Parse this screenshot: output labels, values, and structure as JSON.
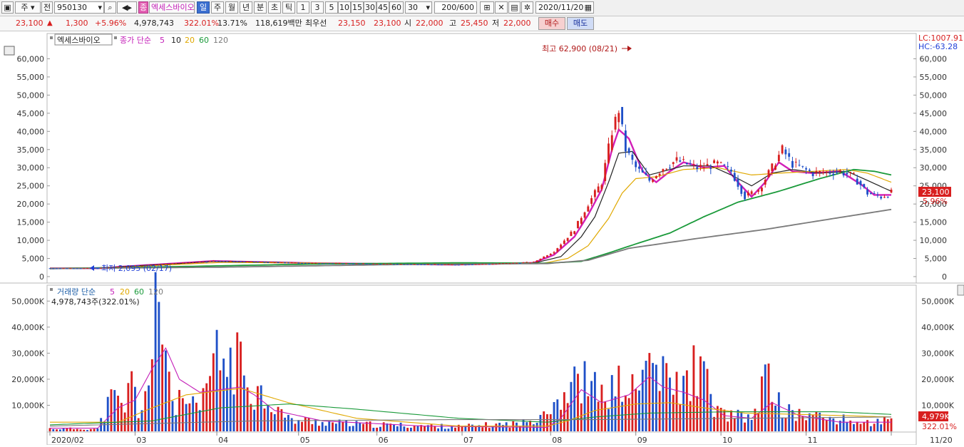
{
  "toolbar": {
    "period_type": "주",
    "prev_label": "전",
    "code": "950130",
    "stock_badge": "종",
    "stock_name": "엑세스바이오",
    "tf_day": "일",
    "tf_week": "주",
    "tf_month": "월",
    "tf_year": "년",
    "tf_min": "분",
    "tf_sec": "초",
    "tf_tick": "틱",
    "intervals": [
      "1",
      "3",
      "5",
      "10",
      "15",
      "30",
      "45",
      "60"
    ],
    "interval_select": "30",
    "count": "200",
    "count_total": "/600",
    "date": "2020/11/20"
  },
  "quote": {
    "price": "23,100",
    "up_arrow": "▲",
    "change": "1,300",
    "change_pct": "+5.96%",
    "volume": "4,978,743",
    "volume_pct": "322.01%",
    "turnover": "13.71%",
    "amount": "118,619백만",
    "best_label": "최우선",
    "best_ask": "23,150",
    "best_bid": "23,100",
    "open_label": "시",
    "open": "22,000",
    "high_label": "고",
    "high": "25,450",
    "low_label": "저",
    "low": "22,000",
    "buy_label": "매수",
    "sell_label": "매도"
  },
  "chart_data": [
    {
      "type": "candlestick",
      "title": "엑세스바이오",
      "legend_prefix": "종가 단순",
      "ma_periods": [
        "5",
        "10",
        "20",
        "60",
        "120"
      ],
      "ma_colors": [
        "#d21fb8",
        "#222222",
        "#e0a800",
        "#1a9a3a",
        "#7a7a7a"
      ],
      "ylim": [
        0,
        65000
      ],
      "y_ticks": [
        0,
        5000,
        10000,
        15000,
        20000,
        25000,
        30000,
        35000,
        40000,
        45000,
        50000,
        55000,
        60000
      ],
      "y_tick_labels": [
        "0",
        "5,000",
        "10,000",
        "15,000",
        "20,000",
        "25,000",
        "30,000",
        "35,000",
        "40,000",
        "45,000",
        "50,000",
        "55,000",
        "60,000"
      ],
      "lc_label": "LC:1007.91",
      "hc_label": "HC:-63.28",
      "high_annotation": "최고 62,900 (08/21)",
      "low_annotation": "최저 2,095 (02/17)",
      "last_price_label": "23,100",
      "last_change_label": "5.96%",
      "price_anchors": [
        [
          0,
          2300
        ],
        [
          14,
          2300
        ],
        [
          24,
          2900
        ],
        [
          36,
          3600
        ],
        [
          48,
          4300
        ],
        [
          62,
          4000
        ],
        [
          78,
          3700
        ],
        [
          98,
          3500
        ],
        [
          118,
          3300
        ],
        [
          130,
          3500
        ],
        [
          142,
          4000
        ],
        [
          148,
          7000
        ],
        [
          154,
          13000
        ],
        [
          158,
          20000
        ],
        [
          162,
          26000
        ],
        [
          165,
          40000
        ],
        [
          167,
          46000
        ],
        [
          169,
          35000
        ],
        [
          172,
          30000
        ],
        [
          176,
          26500
        ],
        [
          180,
          30000
        ],
        [
          184,
          32000
        ],
        [
          190,
          30000
        ],
        [
          196,
          31000
        ],
        [
          200,
          29000
        ],
        [
          204,
          22000
        ],
        [
          208,
          24000
        ],
        [
          212,
          30000
        ],
        [
          215,
          35000
        ],
        [
          218,
          31000
        ],
        [
          224,
          28500
        ],
        [
          232,
          29000
        ],
        [
          236,
          27500
        ],
        [
          240,
          23000
        ],
        [
          244,
          22000
        ],
        [
          247,
          23100
        ]
      ],
      "ma_anchors": {
        "5": [
          [
            0,
            2300
          ],
          [
            14,
            2300
          ],
          [
            24,
            2900
          ],
          [
            36,
            3600
          ],
          [
            48,
            4300
          ],
          [
            62,
            4000
          ],
          [
            78,
            3700
          ],
          [
            98,
            3500
          ],
          [
            118,
            3300
          ],
          [
            130,
            3500
          ],
          [
            142,
            3800
          ],
          [
            148,
            6000
          ],
          [
            154,
            11000
          ],
          [
            158,
            17000
          ],
          [
            162,
            24000
          ],
          [
            165,
            35000
          ],
          [
            167,
            40500
          ],
          [
            170,
            38000
          ],
          [
            174,
            29000
          ],
          [
            178,
            26000
          ],
          [
            182,
            29000
          ],
          [
            186,
            31500
          ],
          [
            192,
            30000
          ],
          [
            198,
            30500
          ],
          [
            202,
            26000
          ],
          [
            206,
            22000
          ],
          [
            210,
            26000
          ],
          [
            214,
            31500
          ],
          [
            218,
            29000
          ],
          [
            224,
            28500
          ],
          [
            232,
            29000
          ],
          [
            238,
            25500
          ],
          [
            242,
            22500
          ],
          [
            247,
            22500
          ]
        ],
        "10": [
          [
            0,
            2300
          ],
          [
            14,
            2300
          ],
          [
            24,
            2900
          ],
          [
            36,
            3500
          ],
          [
            48,
            4200
          ],
          [
            62,
            4000
          ],
          [
            78,
            3700
          ],
          [
            98,
            3500
          ],
          [
            118,
            3300
          ],
          [
            130,
            3500
          ],
          [
            142,
            3700
          ],
          [
            150,
            5500
          ],
          [
            156,
            11000
          ],
          [
            160,
            16500
          ],
          [
            164,
            26000
          ],
          [
            167,
            34000
          ],
          [
            171,
            34500
          ],
          [
            176,
            28000
          ],
          [
            180,
            29000
          ],
          [
            186,
            30500
          ],
          [
            194,
            30500
          ],
          [
            200,
            28000
          ],
          [
            206,
            25000
          ],
          [
            212,
            28500
          ],
          [
            218,
            29500
          ],
          [
            226,
            28500
          ],
          [
            234,
            29000
          ],
          [
            240,
            26500
          ],
          [
            247,
            23500
          ]
        ],
        "20": [
          [
            0,
            2300
          ],
          [
            20,
            2500
          ],
          [
            36,
            3300
          ],
          [
            50,
            3900
          ],
          [
            70,
            3800
          ],
          [
            100,
            3500
          ],
          [
            130,
            3500
          ],
          [
            145,
            3700
          ],
          [
            152,
            5000
          ],
          [
            158,
            8500
          ],
          [
            164,
            16000
          ],
          [
            168,
            23000
          ],
          [
            172,
            27000
          ],
          [
            178,
            27500
          ],
          [
            186,
            29500
          ],
          [
            196,
            30000
          ],
          [
            206,
            28000
          ],
          [
            214,
            28500
          ],
          [
            224,
            29000
          ],
          [
            234,
            29500
          ],
          [
            240,
            28500
          ],
          [
            247,
            26000
          ]
        ],
        "60": [
          [
            0,
            2200
          ],
          [
            40,
            2800
          ],
          [
            80,
            3500
          ],
          [
            120,
            3800
          ],
          [
            146,
            3700
          ],
          [
            156,
            4200
          ],
          [
            164,
            6500
          ],
          [
            172,
            9000
          ],
          [
            182,
            12000
          ],
          [
            192,
            16500
          ],
          [
            202,
            20500
          ],
          [
            214,
            23500
          ],
          [
            226,
            27000
          ],
          [
            236,
            29500
          ],
          [
            242,
            29000
          ],
          [
            247,
            28000
          ]
        ],
        "120": [
          [
            0,
            2200
          ],
          [
            50,
            2600
          ],
          [
            100,
            3300
          ],
          [
            146,
            3600
          ],
          [
            158,
            4500
          ],
          [
            170,
            7800
          ],
          [
            190,
            10500
          ],
          [
            210,
            13000
          ],
          [
            230,
            16000
          ],
          [
            247,
            18500
          ]
        ]
      }
    },
    {
      "type": "bar",
      "title": "거래량",
      "legend_prefix": "거래량 단순",
      "ma_periods": [
        "5",
        "20",
        "60",
        "120"
      ],
      "ma_colors": [
        "#c41fb8",
        "#e0a800",
        "#1a9a3a",
        "#7a7a7a"
      ],
      "summary": "4,978,743주(322.01%)",
      "ylim": [
        0,
        52000
      ],
      "y_ticks": [
        10000,
        20000,
        30000,
        40000,
        50000
      ],
      "y_tick_labels": [
        "10,000K",
        "20,000K",
        "30,000K",
        "40,000K",
        "50,000K"
      ],
      "last_volume_label": "4,979K",
      "last_pct_label": "322.01%",
      "volume_anchors": [
        [
          0,
          1200
        ],
        [
          14,
          1000
        ],
        [
          18,
          14000
        ],
        [
          22,
          10000
        ],
        [
          24,
          22500
        ],
        [
          26,
          8000
        ],
        [
          30,
          26000
        ],
        [
          31,
          47500
        ],
        [
          34,
          41000
        ],
        [
          36,
          12000
        ],
        [
          40,
          12000
        ],
        [
          44,
          8000
        ],
        [
          48,
          30500
        ],
        [
          56,
          28500
        ],
        [
          60,
          18000
        ],
        [
          64,
          14000
        ],
        [
          70,
          5000
        ],
        [
          90,
          3000
        ],
        [
          120,
          2000
        ],
        [
          140,
          3500
        ],
        [
          156,
          22000
        ],
        [
          162,
          15000
        ],
        [
          168,
          20000
        ],
        [
          172,
          16000
        ],
        [
          176,
          31000
        ],
        [
          180,
          22000
        ],
        [
          186,
          18000
        ],
        [
          190,
          29000
        ],
        [
          196,
          8000
        ],
        [
          206,
          5000
        ],
        [
          210,
          22500
        ],
        [
          216,
          8000
        ],
        [
          240,
          3500
        ],
        [
          247,
          4979
        ]
      ],
      "vol_ma_anchors": {
        "5": [
          [
            0,
            1200
          ],
          [
            14,
            1200
          ],
          [
            20,
            9000
          ],
          [
            25,
            12000
          ],
          [
            30,
            24000
          ],
          [
            34,
            32000
          ],
          [
            38,
            20000
          ],
          [
            44,
            15000
          ],
          [
            50,
            16000
          ],
          [
            56,
            17000
          ],
          [
            60,
            14000
          ],
          [
            66,
            8000
          ],
          [
            80,
            4000
          ],
          [
            110,
            2000
          ],
          [
            146,
            1500
          ],
          [
            150,
            5000
          ],
          [
            156,
            16000
          ],
          [
            162,
            11000
          ],
          [
            170,
            14000
          ],
          [
            176,
            21000
          ],
          [
            180,
            17000
          ],
          [
            186,
            15000
          ],
          [
            192,
            12000
          ],
          [
            198,
            6000
          ],
          [
            206,
            5000
          ],
          [
            212,
            11000
          ],
          [
            220,
            6000
          ],
          [
            232,
            3500
          ],
          [
            247,
            3500
          ]
        ],
        "20": [
          [
            0,
            3500
          ],
          [
            20,
            3500
          ],
          [
            30,
            9000
          ],
          [
            40,
            14000
          ],
          [
            56,
            16500
          ],
          [
            70,
            11000
          ],
          [
            90,
            5000
          ],
          [
            120,
            2000
          ],
          [
            146,
            2000
          ],
          [
            152,
            4000
          ],
          [
            160,
            8000
          ],
          [
            172,
            10500
          ],
          [
            182,
            11000
          ],
          [
            192,
            9000
          ],
          [
            204,
            7000
          ],
          [
            220,
            6500
          ],
          [
            247,
            5500
          ]
        ],
        "60": [
          [
            0,
            2500
          ],
          [
            30,
            4000
          ],
          [
            50,
            9000
          ],
          [
            70,
            10500
          ],
          [
            90,
            8500
          ],
          [
            120,
            5000
          ],
          [
            146,
            3500
          ],
          [
            160,
            5500
          ],
          [
            176,
            7000
          ],
          [
            200,
            7500
          ],
          [
            230,
            7500
          ],
          [
            247,
            6500
          ]
        ],
        "120": [
          [
            0,
            2000
          ],
          [
            60,
            4000
          ],
          [
            120,
            4500
          ],
          [
            160,
            4500
          ],
          [
            247,
            5500
          ]
        ]
      }
    }
  ],
  "x_axis": {
    "labels": [
      "2020/02",
      "03",
      "04",
      "05",
      "06",
      "07",
      "08",
      "09",
      "10",
      "11",
      "11/20"
    ],
    "label_index": [
      0,
      25,
      49,
      73,
      96,
      121,
      147,
      172,
      197,
      222,
      247
    ]
  }
}
